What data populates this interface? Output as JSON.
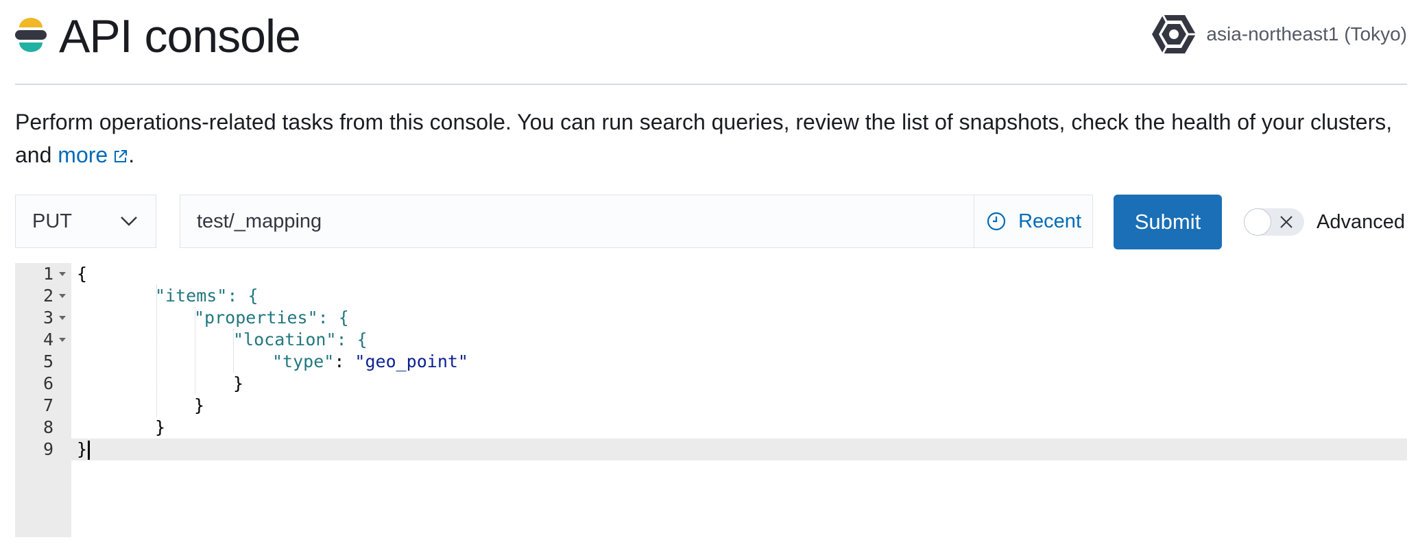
{
  "header": {
    "title": "API console",
    "region": "asia-northeast1 (Tokyo)",
    "logo_icon": "elastic-logo-icon",
    "region_icon": "google-cloud-icon"
  },
  "intro": {
    "text": "Perform operations-related tasks from this console. You can run search queries, review the list of snapshots, check the health of your clusters, and ",
    "link_label": "more",
    "suffix": "."
  },
  "request": {
    "method": "PUT",
    "path": "test/_mapping",
    "recent_label": "Recent",
    "submit_label": "Submit",
    "advanced_label": "Advanced",
    "advanced_enabled": false
  },
  "editor": {
    "lines": [
      {
        "num": "1",
        "text": "{"
      },
      {
        "num": "2",
        "text": "\"items\": {"
      },
      {
        "num": "3",
        "text": "\"properties\": {"
      },
      {
        "num": "4",
        "text": "\"location\": {"
      },
      {
        "num": "5",
        "text": "\"type\": \"geo_point\""
      },
      {
        "num": "6",
        "text": "}"
      },
      {
        "num": "7",
        "text": "}"
      },
      {
        "num": "8",
        "text": "}"
      },
      {
        "num": "9",
        "text": "}"
      }
    ]
  },
  "colors": {
    "accent": "#1b6fb6",
    "link": "#006bb8",
    "json_key": "#23777f",
    "json_string": "#0b2293"
  }
}
